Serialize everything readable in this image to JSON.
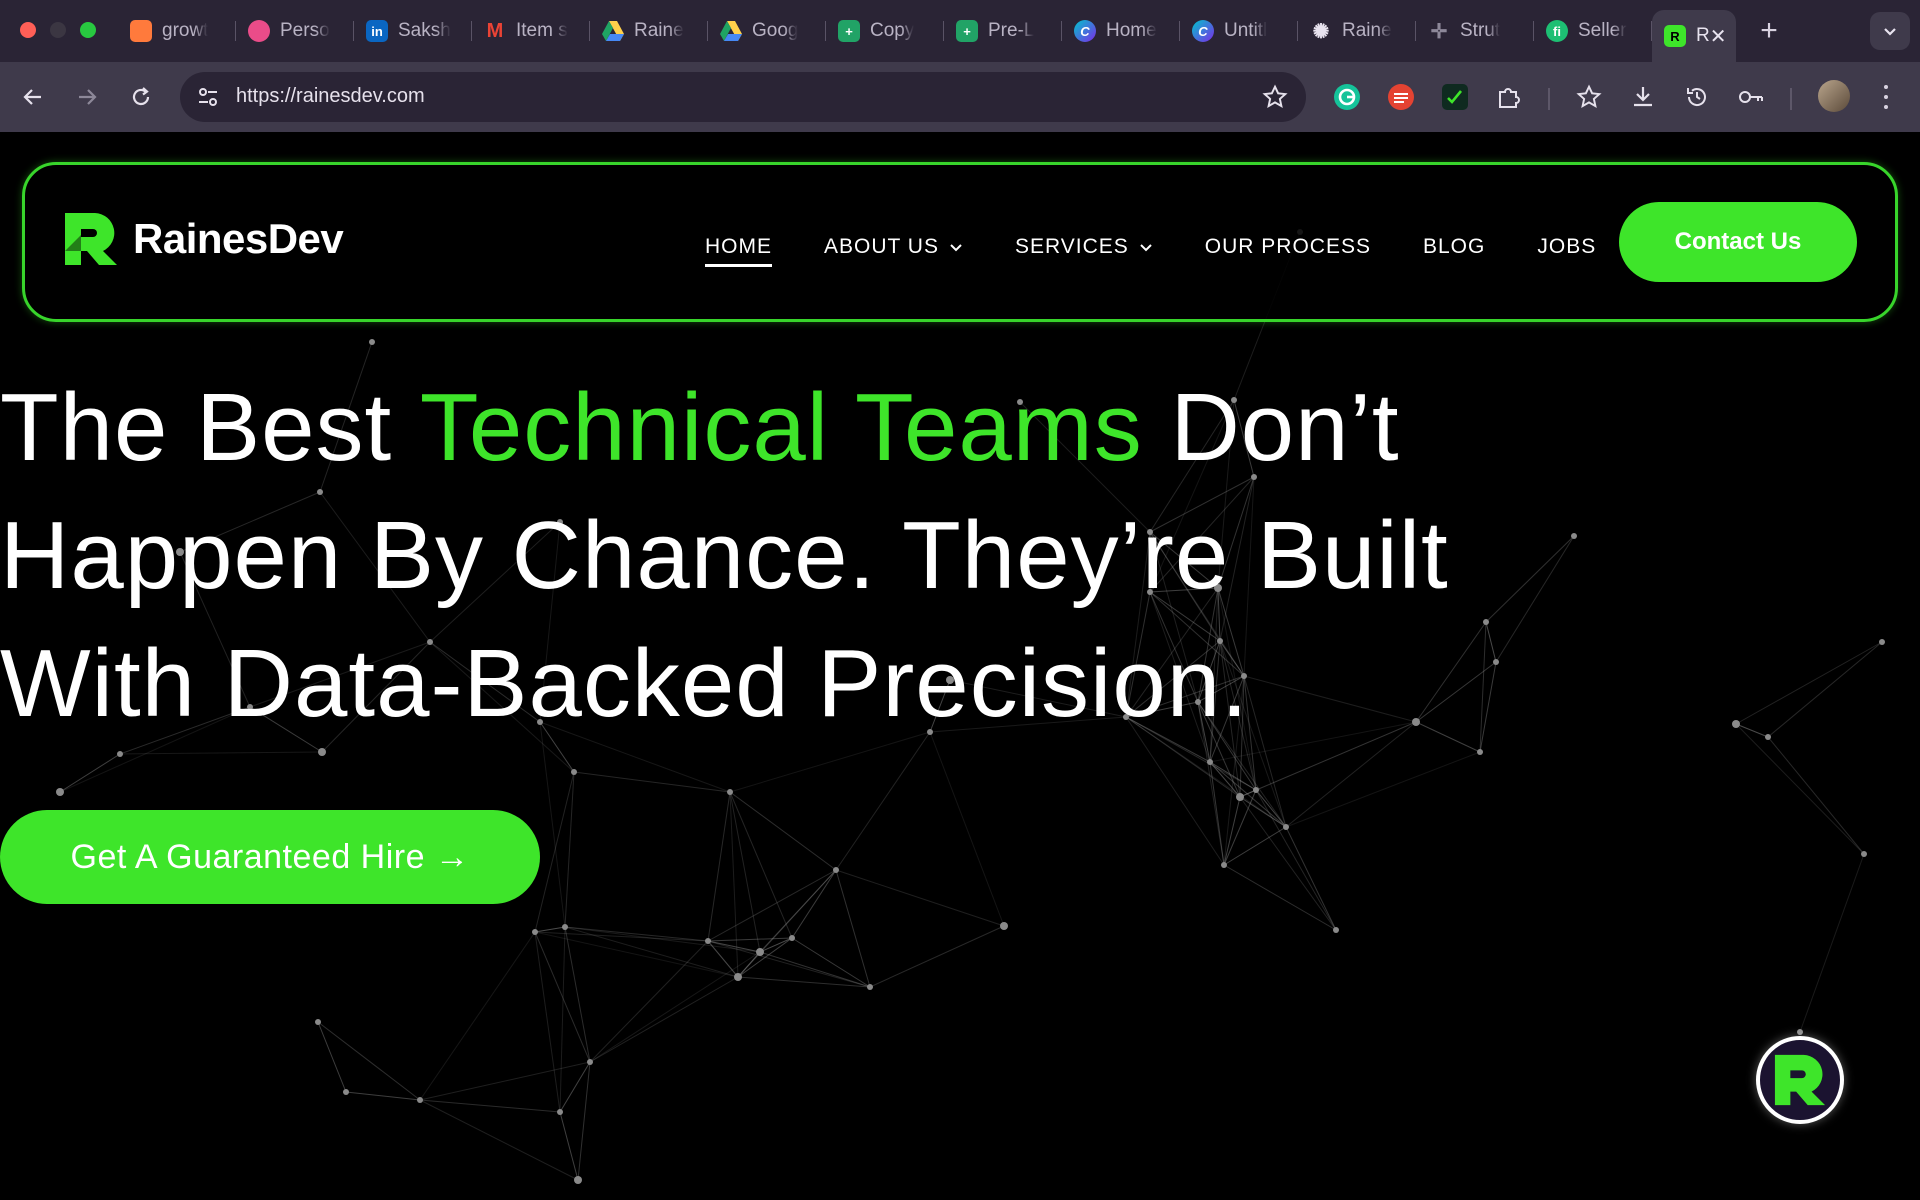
{
  "browser": {
    "tabs": [
      {
        "label": "growt",
        "icon": "figma-like-icon",
        "color": "#ff7a3c"
      },
      {
        "label": "Perso",
        "icon": "dribbble-icon",
        "color": "#ea4c89"
      },
      {
        "label": "Saksh",
        "icon": "linkedin-icon",
        "color": "#0a66c2"
      },
      {
        "label": "Item s",
        "icon": "gmail-icon",
        "color": "#ea4335"
      },
      {
        "label": "Raine",
        "icon": "google-drive-icon",
        "color": "#1fa463"
      },
      {
        "label": "Goog",
        "icon": "google-drive-icon",
        "color": "#ffd04b"
      },
      {
        "label": "Copy",
        "icon": "google-sheets-icon",
        "color": "#21a366"
      },
      {
        "label": "Pre-L",
        "icon": "google-sheets-icon",
        "color": "#21a366"
      },
      {
        "label": "Home",
        "icon": "canva-icon",
        "color": "#7d2ae8"
      },
      {
        "label": "Untitl",
        "icon": "canva-icon",
        "color": "#00c4cc"
      },
      {
        "label": "Raine",
        "icon": "chatgpt-icon",
        "color": "#ffffff"
      },
      {
        "label": "Strut",
        "icon": "sparkle-icon",
        "color": "#8d8899"
      },
      {
        "label": "Seller",
        "icon": "fiverr-icon",
        "color": "#1dbf73"
      }
    ],
    "active_tab": {
      "label": "R",
      "icon": "rainesdev-favicon",
      "close": "✕"
    },
    "new_tab": "+",
    "url": "https://rainesdev.com"
  },
  "site": {
    "logo_text": "RainesDev",
    "nav": [
      {
        "label": "HOME",
        "active": true
      },
      {
        "label": "ABOUT US",
        "dropdown": true
      },
      {
        "label": "SERVICES",
        "dropdown": true
      },
      {
        "label": "OUR PROCESS"
      },
      {
        "label": "BLOG"
      },
      {
        "label": "JOBS"
      }
    ],
    "contact_label": "Contact Us",
    "hero": {
      "part1": "The Best ",
      "accent": "Technical Teams",
      "part2": " Don’t",
      "line2": "Happen By Chance. They’re Built",
      "line3": "With Data-Backed Precision."
    },
    "cta_label": "Get A Guaranteed Hire →",
    "colors": {
      "accent": "#3ee52a",
      "background": "#000000"
    }
  }
}
